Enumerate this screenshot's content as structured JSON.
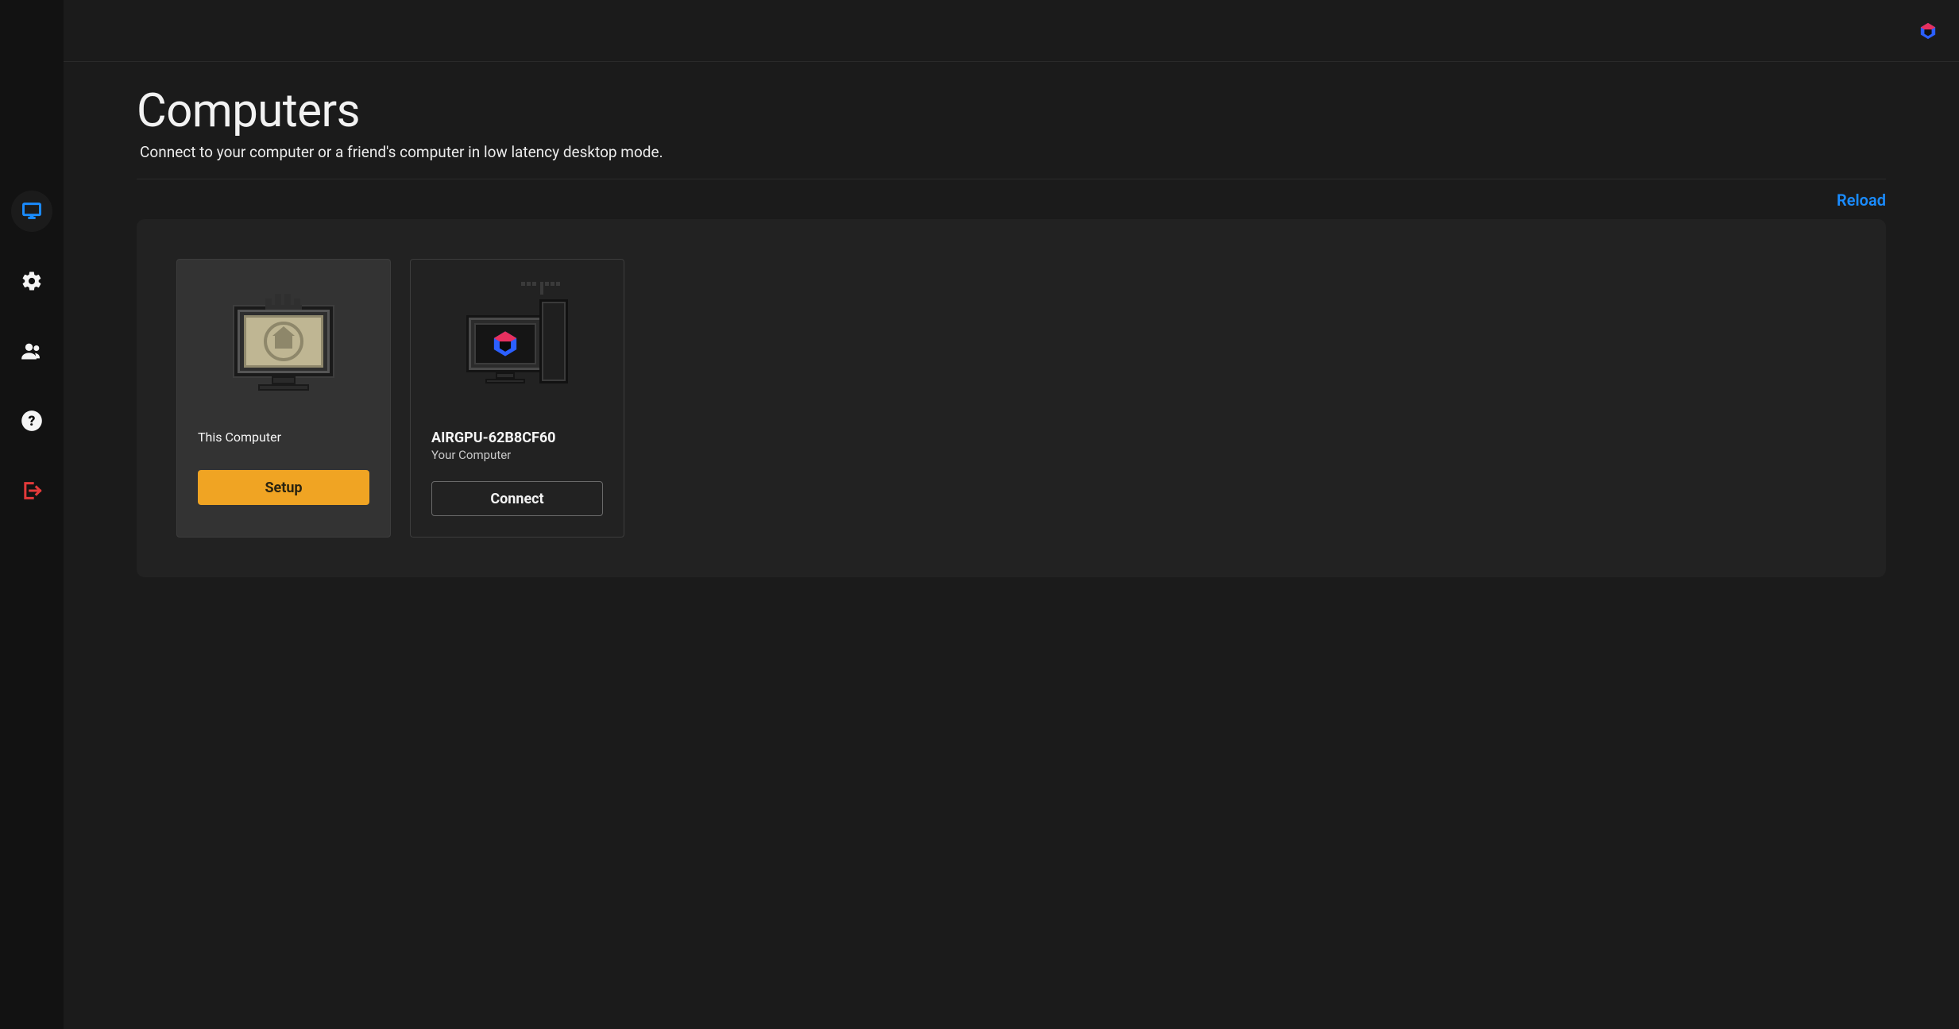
{
  "header": {
    "title": "Computers",
    "subtitle": "Connect to your computer or a friend's computer in low latency desktop mode."
  },
  "toolbar": {
    "reload_label": "Reload"
  },
  "cards": {
    "local": {
      "title": "This Computer",
      "button": "Setup"
    },
    "remote": {
      "title": "AIRGPU-62B8CF60",
      "subtitle": "Your Computer",
      "button": "Connect"
    }
  },
  "sidebar": {
    "items": [
      {
        "name": "computers",
        "active": true
      },
      {
        "name": "settings",
        "active": false
      },
      {
        "name": "friends",
        "active": false
      },
      {
        "name": "help",
        "active": false
      },
      {
        "name": "logout",
        "active": false
      }
    ]
  },
  "colors": {
    "accent_blue": "#1a8cff",
    "accent_orange": "#f0a423",
    "danger_red": "#e33a3a",
    "brand_pink": "#e7305f",
    "brand_blue": "#2b5fff"
  }
}
